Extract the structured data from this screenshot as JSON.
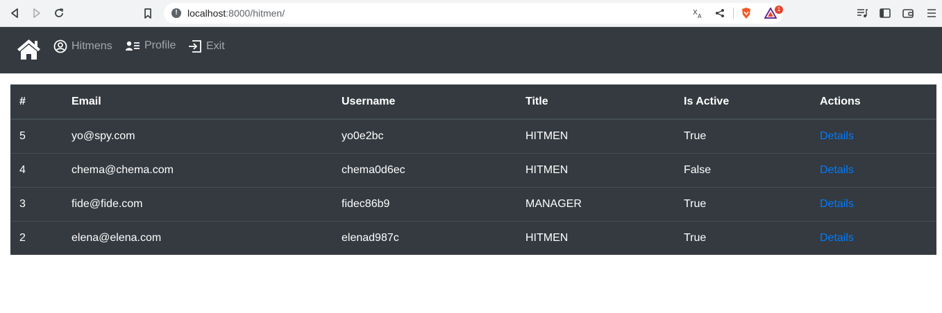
{
  "browser": {
    "url_host": "localhost",
    "url_rest": ":8000/hitmen/",
    "extension_badge": "1",
    "icons": [
      "back-icon",
      "forward-icon",
      "reload-icon",
      "bookmark-icon",
      "site-info-icon",
      "translate-icon",
      "share-icon",
      "brave-shields-icon",
      "brave-rewards-icon",
      "media-icon",
      "sidebar-icon",
      "wallet-icon",
      "menu-icon"
    ]
  },
  "navbar": {
    "home_icon": "home-icon",
    "items": [
      {
        "label": "Hitmens",
        "icon": "user-circle-icon"
      },
      {
        "label": "Profile",
        "icon": "id-card-icon"
      },
      {
        "label": "Exit",
        "icon": "sign-out-icon"
      }
    ],
    "text_color": "#8c9196",
    "background": "#343a40"
  },
  "table": {
    "headers": [
      "#",
      "Email",
      "Username",
      "Title",
      "Is Active",
      "Actions"
    ],
    "rows": [
      {
        "id": "5",
        "email": "yo@spy.com",
        "username": "yo0e2bc",
        "title": "HITMEN",
        "is_active": "True",
        "action": "Details"
      },
      {
        "id": "4",
        "email": "chema@chema.com",
        "username": "chema0d6ec",
        "title": "HITMEN",
        "is_active": "False",
        "action": "Details"
      },
      {
        "id": "3",
        "email": "fide@fide.com",
        "username": "fidec86b9",
        "title": "MANAGER",
        "is_active": "True",
        "action": "Details"
      },
      {
        "id": "2",
        "email": "elena@elena.com",
        "username": "elenad987c",
        "title": "HITMEN",
        "is_active": "True",
        "action": "Details"
      }
    ],
    "background": "#343a40",
    "link_color": "#007bff"
  }
}
